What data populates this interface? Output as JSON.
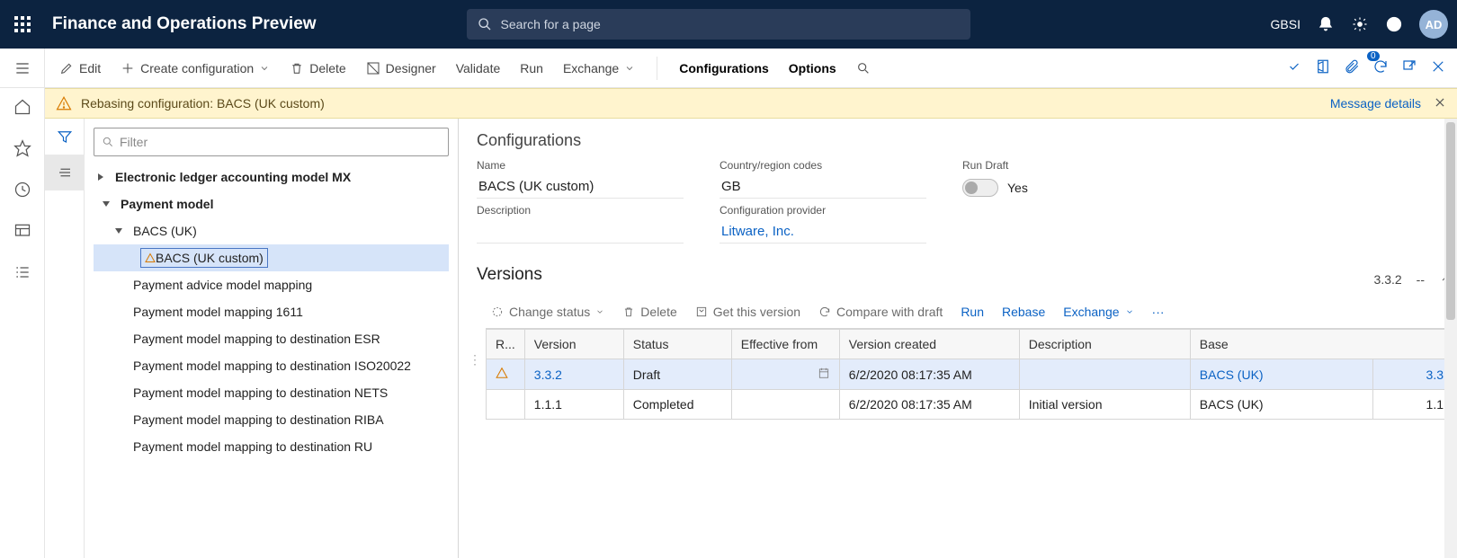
{
  "topbar": {
    "app_title": "Finance and Operations Preview",
    "search_placeholder": "Search for a page",
    "company": "GBSI",
    "avatar": "AD"
  },
  "cmdbar": {
    "edit": "Edit",
    "create_cfg": "Create configuration",
    "delete": "Delete",
    "designer": "Designer",
    "validate": "Validate",
    "run": "Run",
    "exchange": "Exchange",
    "configs": "Configurations",
    "options": "Options",
    "attachments_count": "0"
  },
  "warning": {
    "text": "Rebasing configuration: BACS (UK custom)",
    "details": "Message details"
  },
  "tree": {
    "filter_placeholder": "Filter",
    "items": [
      "Electronic ledger accounting model MX",
      "Payment model",
      "BACS (UK)",
      "BACS (UK custom)",
      "Payment advice model mapping",
      "Payment model mapping 1611",
      "Payment model mapping to destination ESR",
      "Payment model mapping to destination ISO20022",
      "Payment model mapping to destination NETS",
      "Payment model mapping to destination RIBA",
      "Payment model mapping to destination RU"
    ]
  },
  "details": {
    "section_title": "Configurations",
    "name_label": "Name",
    "name_value": "BACS (UK custom)",
    "country_label": "Country/region codes",
    "country_value": "GB",
    "rundraft_label": "Run Draft",
    "rundraft_value": "Yes",
    "desc_label": "Description",
    "provider_label": "Configuration provider",
    "provider_value": "Litware, Inc."
  },
  "versions": {
    "title": "Versions",
    "badge": "3.3.2",
    "dashes": "--",
    "toolbar": {
      "change_status": "Change status",
      "delete": "Delete",
      "get_version": "Get this version",
      "compare": "Compare with draft",
      "run": "Run",
      "rebase": "Rebase",
      "exchange": "Exchange"
    },
    "columns": {
      "r": "R...",
      "version": "Version",
      "status": "Status",
      "effective": "Effective from",
      "created": "Version created",
      "description": "Description",
      "base": "Base"
    },
    "rows": [
      {
        "warn": true,
        "version": "3.3.2",
        "status": "Draft",
        "created": "6/2/2020 08:17:35 AM",
        "description": "",
        "base": "BACS (UK)",
        "basever": "3.3",
        "link": true
      },
      {
        "warn": false,
        "version": "1.1.1",
        "status": "Completed",
        "created": "6/2/2020 08:17:35 AM",
        "description": "Initial version",
        "base": "BACS (UK)",
        "basever": "1.1",
        "link": false
      }
    ]
  }
}
